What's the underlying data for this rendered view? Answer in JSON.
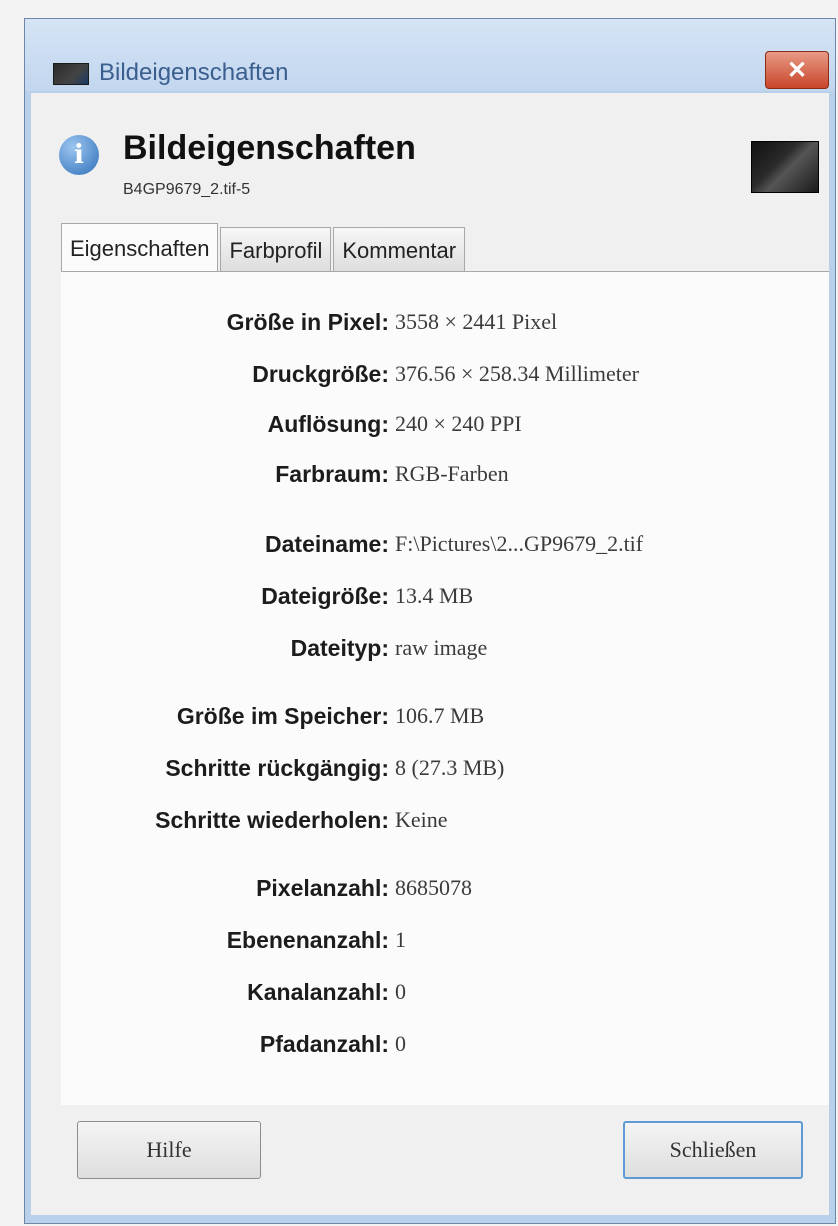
{
  "window": {
    "title": "Bildeigenschaften",
    "close_symbol": "✕"
  },
  "header": {
    "title": "Bildeigenschaften",
    "subtitle": "B4GP9679_2.tif-5",
    "info_icon": "info-icon",
    "thumbnail": "image-thumbnail"
  },
  "tabs": [
    {
      "label": "Eigenschaften",
      "active": true
    },
    {
      "label": "Farbprofil",
      "active": false
    },
    {
      "label": "Kommentar",
      "active": false
    }
  ],
  "properties": [
    {
      "label": "Größe in Pixel:",
      "value": "3558 × 2441 Pixel"
    },
    {
      "label": "Druckgröße:",
      "value": "376.56 × 258.34 Millimeter"
    },
    {
      "label": "Auflösung:",
      "value": "240 × 240 PPI"
    },
    {
      "label": "Farbraum:",
      "value": "RGB-Farben"
    },
    {
      "label": "Dateiname:",
      "value": "F:\\Pictures\\2...GP9679_2.tif"
    },
    {
      "label": "Dateigröße:",
      "value": "13.4 MB"
    },
    {
      "label": "Dateityp:",
      "value": "raw image"
    },
    {
      "label": "Größe im Speicher:",
      "value": "106.7 MB"
    },
    {
      "label": "Schritte rückgängig:",
      "value": "8 (27.3 MB)"
    },
    {
      "label": "Schritte wiederholen:",
      "value": "Keine"
    },
    {
      "label": "Pixelanzahl:",
      "value": "8685078"
    },
    {
      "label": "Ebenenanzahl:",
      "value": "1"
    },
    {
      "label": "Kanalanzahl:",
      "value": "0"
    },
    {
      "label": "Pfadanzahl:",
      "value": "0"
    }
  ],
  "footer": {
    "help_label": "Hilfe",
    "close_label": "Schließen"
  }
}
